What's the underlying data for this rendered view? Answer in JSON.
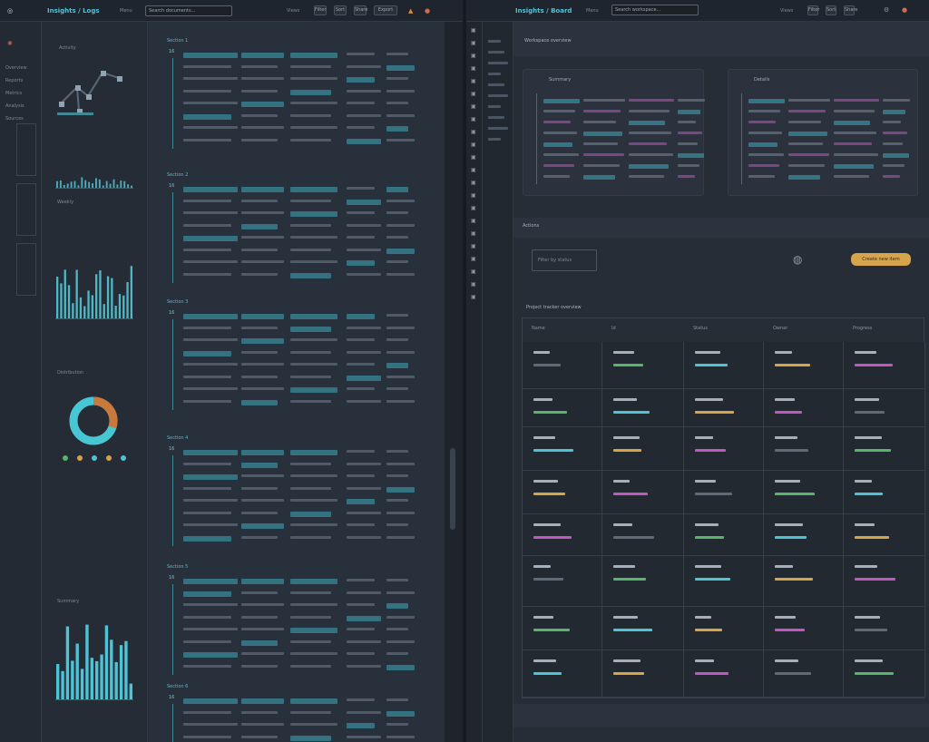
{
  "left_window": {
    "title": "Insights / Logs",
    "menu_label": "Menu",
    "search_placeholder": "Search documents...",
    "toolbar": [
      "Views",
      "Filter",
      "Sort",
      "Share",
      "Export"
    ],
    "nav": [
      "Overview",
      "Reports",
      "Metrics",
      "Analysis",
      "Sources"
    ],
    "sidebar_caption_1": "Activity",
    "sidebar_caption_2": "Weekly",
    "sidebar_caption_3": "Distribution",
    "sidebar_caption_4": "Summary",
    "sections": [
      {
        "heading": "Section 1",
        "badge": "16"
      },
      {
        "heading": "Section 2",
        "badge": "16"
      },
      {
        "heading": "Section 3",
        "badge": "16"
      },
      {
        "heading": "Section 4",
        "badge": "16"
      },
      {
        "heading": "Section 5",
        "badge": "16"
      },
      {
        "heading": "Section 6",
        "badge": "16"
      }
    ]
  },
  "right_window": {
    "title": "Insights / Board",
    "menu_label": "Menu",
    "search_placeholder": "Search workspace...",
    "toolbar": [
      "Views",
      "Filter",
      "Sort",
      "Share"
    ],
    "page_heading": "Workspace overview",
    "card_a_title": "Summary",
    "card_b_title": "Details",
    "section_heading": "Actions",
    "action_input": "Filter by status",
    "primary_button": "Create new item",
    "table_title": "Project tracker overview",
    "columns": [
      "Name",
      "Id",
      "Status",
      "Owner",
      "Progress"
    ]
  },
  "colors": {
    "accent_teal": "#4fc3d6",
    "accent_magenta": "#be5abe",
    "accent_amber": "#d6a44a",
    "accent_green": "#59b56a"
  },
  "icons": [
    "menu-icon",
    "search-icon",
    "gear-icon",
    "bell-icon",
    "user-icon",
    "chart-icon",
    "donut-icon"
  ]
}
